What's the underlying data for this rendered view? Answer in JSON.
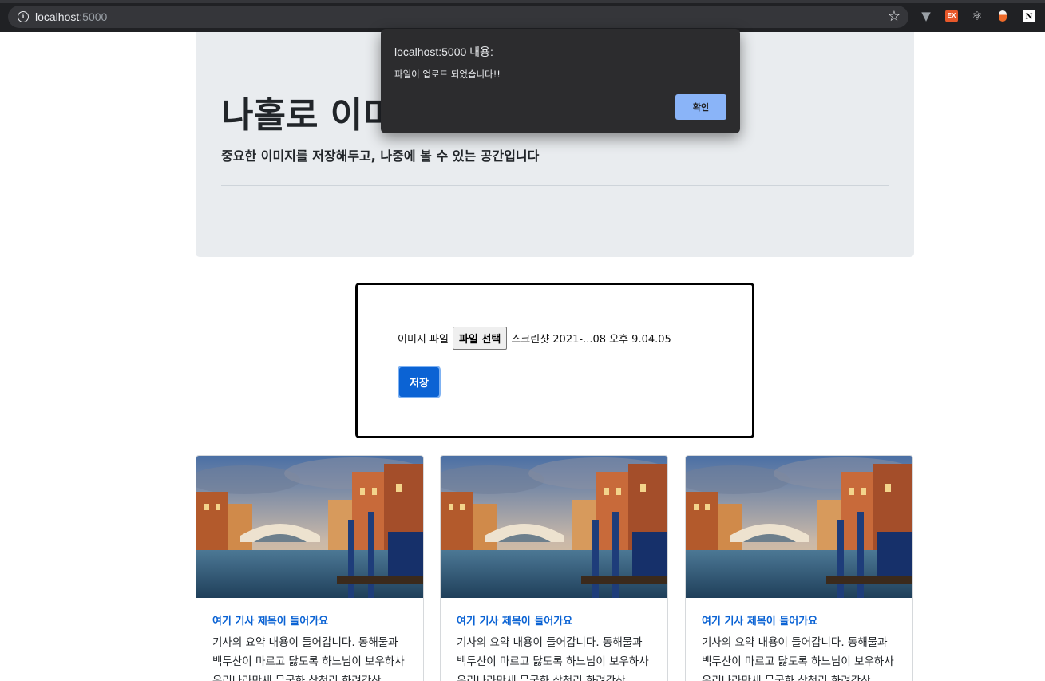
{
  "browser": {
    "url_host": "localhost",
    "url_port": ":5000",
    "icons": [
      "info-icon",
      "star-icon",
      "vue-devtools-icon",
      "ex-extension-icon",
      "react-devtools-icon",
      "capsule-extension-icon",
      "notion-icon"
    ]
  },
  "jumbotron": {
    "title": "나홀로 이미",
    "lead": "중요한 이미지를 저장해두고, 나중에 볼 수 있는 공간입니다"
  },
  "upload": {
    "label": "이미지 파일",
    "choose_button": "파일 선택",
    "file_name": "스크린샷 2021-...08 오후 9.04.05",
    "save_button": "저장"
  },
  "cards": [
    {
      "title": "여기 기사 제목이 들어가요",
      "text": "기사의 요약 내용이 들어갑니다. 동해물과 백두산이 마르고 닳도록 하느님이 보우하사 우리나라만세 무궁화 삼천리 화려강산"
    },
    {
      "title": "여기 기사 제목이 들어가요",
      "text": "기사의 요약 내용이 들어갑니다. 동해물과 백두산이 마르고 닳도록 하느님이 보우하사 우리나라만세 무궁화 삼천리 화려강산"
    },
    {
      "title": "여기 기사 제목이 들어가요",
      "text": "기사의 요약 내용이 들어갑니다. 동해물과 백두산이 마르고 닳도록 하느님이 보우하사 우리나라만세 무궁화 삼천리 화려강산"
    }
  ],
  "alert": {
    "title": "localhost:5000 내용:",
    "message": "파일이 업로드 되었습니다!!",
    "ok_button": "확인"
  },
  "colors": {
    "accent": "#0b63d4",
    "jumbotron_bg": "#e9ecef",
    "dialog_bg": "#2c2c2e",
    "dialog_button": "#8ab4f8"
  }
}
